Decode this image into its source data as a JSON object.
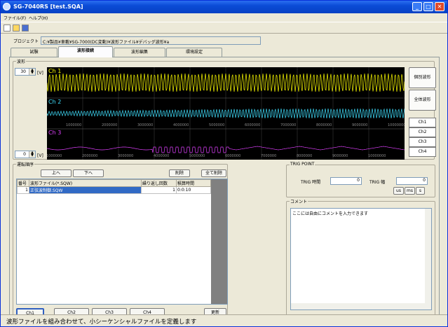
{
  "window": {
    "title": "SG-7040RS [test.SQA]"
  },
  "menu": [
    "ファイル(F)",
    "ヘルプ(H)"
  ],
  "project": {
    "label": "プロジェクト",
    "path": "C:¥製品¥車載¥SG-7000(DC変動)¥波形ファイル¥デバッグ波形¥a"
  },
  "tabs": [
    "試験",
    "波形接続",
    "波形編集",
    "環境設定"
  ],
  "wave": {
    "group_label": "波形",
    "upper_value": "30",
    "lower_value": "0",
    "unit": "[V]",
    "channels": [
      "Ch 1",
      "Ch 2",
      "Ch 3"
    ],
    "time_labels": [
      "1000000",
      "2000000",
      "3000000",
      "4000000",
      "5000000",
      "6000000",
      "7000000",
      "8000000",
      "9000000",
      "10000000"
    ],
    "buttons": {
      "individual": "個別波形",
      "all": "全体波形"
    },
    "channel_buttons": [
      "Ch1",
      "Ch2",
      "Ch3",
      "Ch4"
    ],
    "colors": {
      "ch1": "#ffff00",
      "ch2": "#40e0ff",
      "ch3": "#e040ff",
      "grid": "#3a3a3a"
    }
  },
  "order": {
    "group_label": "運転順序",
    "up": "上へ",
    "down": "下へ",
    "delete": "削除",
    "delete_all": "全て削除",
    "columns": [
      "番号",
      "波形ファイル(*.SQW)",
      "繰り返し回数",
      "積算時間"
    ],
    "rows": [
      {
        "no": "1",
        "file": "正弦波制御.SQW",
        "repeat": "1",
        "time": "0:0:10"
      }
    ],
    "channel_tabs": [
      "Ch1",
      "Ch2",
      "Ch3",
      "Ch4"
    ],
    "refresh": "更新"
  },
  "trig": {
    "group_label": "TRIG POINT",
    "time_label": "TRIG 時間",
    "time_value": "0",
    "width_label": "TRIG 幅",
    "width_value": "0",
    "units": [
      "us",
      "ms",
      "s"
    ]
  },
  "comment": {
    "group_label": "コメント",
    "text": "ここには自由にコメントを入力できます"
  },
  "status": "波形ファイルを組み合わせて、小シーケンシャルファイルを定義します"
}
